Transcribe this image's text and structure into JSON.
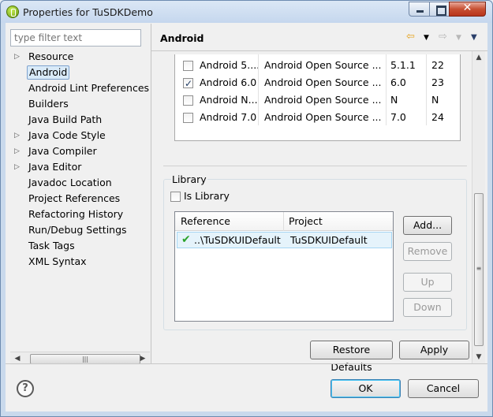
{
  "window": {
    "title": "Properties for TuSDKDemo",
    "close_glyph": "✕"
  },
  "filter": {
    "placeholder": "type filter text"
  },
  "tree": [
    {
      "label": "Resource",
      "expandable": true,
      "selected": false
    },
    {
      "label": "Android",
      "expandable": false,
      "selected": true
    },
    {
      "label": "Android Lint Preferences",
      "expandable": false,
      "selected": false
    },
    {
      "label": "Builders",
      "expandable": false,
      "selected": false
    },
    {
      "label": "Java Build Path",
      "expandable": false,
      "selected": false
    },
    {
      "label": "Java Code Style",
      "expandable": true,
      "selected": false
    },
    {
      "label": "Java Compiler",
      "expandable": true,
      "selected": false
    },
    {
      "label": "Java Editor",
      "expandable": true,
      "selected": false
    },
    {
      "label": "Javadoc Location",
      "expandable": false,
      "selected": false
    },
    {
      "label": "Project References",
      "expandable": false,
      "selected": false
    },
    {
      "label": "Refactoring History",
      "expandable": false,
      "selected": false
    },
    {
      "label": "Run/Debug Settings",
      "expandable": false,
      "selected": false
    },
    {
      "label": "Task Tags",
      "expandable": false,
      "selected": false
    },
    {
      "label": "XML Syntax",
      "expandable": false,
      "selected": false
    }
  ],
  "page": {
    "title": "Android"
  },
  "targets": [
    {
      "name": "Android 5....",
      "vendor": "Android Open Source ...",
      "platform": "5.1.1",
      "api": "22",
      "checked": false
    },
    {
      "name": "Android 6.0",
      "vendor": "Android Open Source ...",
      "platform": "6.0",
      "api": "23",
      "checked": true
    },
    {
      "name": "Android N...",
      "vendor": "Android Open Source ...",
      "platform": "N",
      "api": "N",
      "checked": false
    },
    {
      "name": "Android 7.0",
      "vendor": "Android Open Source ...",
      "platform": "7.0",
      "api": "24",
      "checked": false
    }
  ],
  "library": {
    "legend": "Library",
    "is_library_label": "Is Library",
    "is_library_checked": false,
    "columns": {
      "reference": "Reference",
      "project": "Project"
    },
    "rows": [
      {
        "reference": "..\\TuSDKUIDefault",
        "project": "TuSDKUIDefault"
      }
    ],
    "buttons": {
      "add": "Add...",
      "remove": "Remove",
      "up": "Up",
      "down": "Down"
    }
  },
  "page_buttons": {
    "restore": "Restore Defaults",
    "apply": "Apply"
  },
  "dialog_buttons": {
    "ok": "OK",
    "cancel": "Cancel"
  },
  "help": {
    "glyph": "?"
  }
}
